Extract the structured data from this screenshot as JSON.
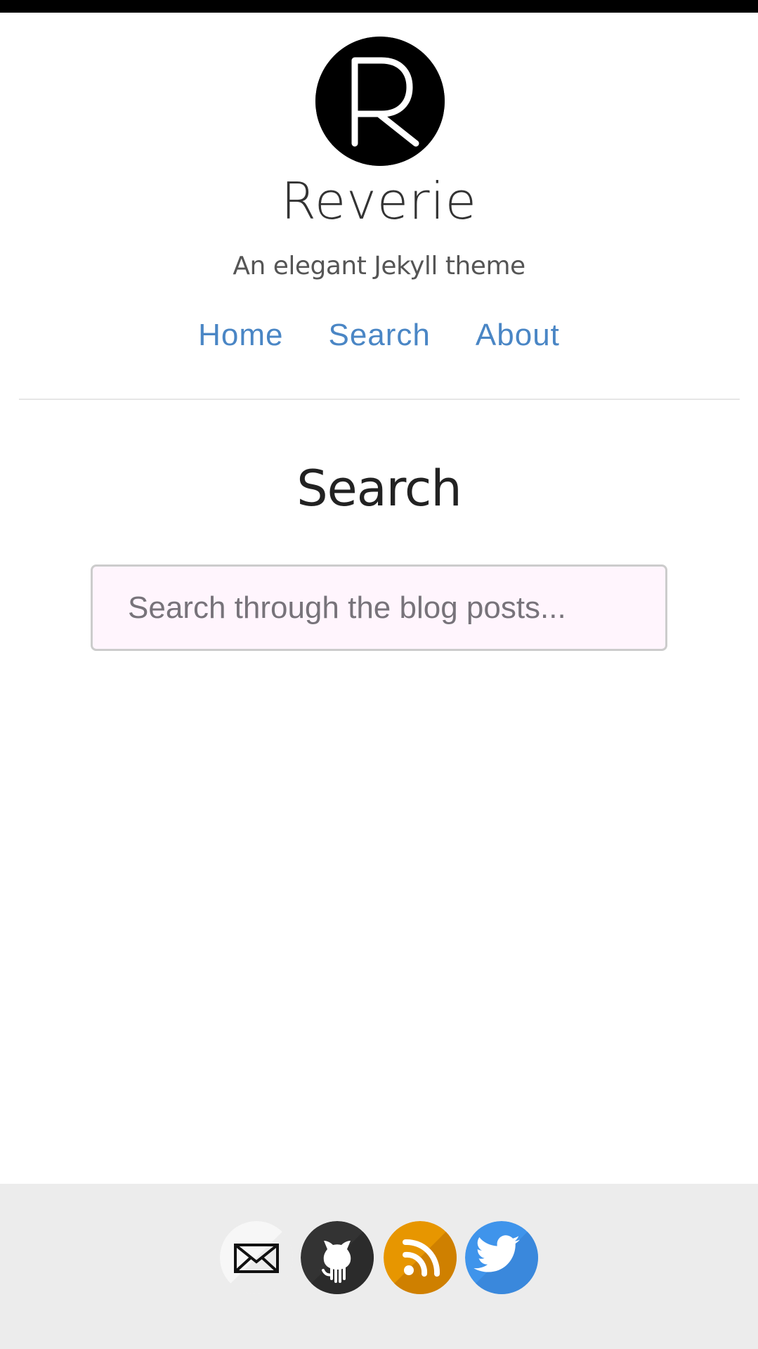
{
  "header": {
    "logo_icon": "reverie-r-logo-icon",
    "site_title": "Reverie",
    "tagline": "An elegant Jekyll theme"
  },
  "nav": {
    "items": [
      {
        "label": "Home"
      },
      {
        "label": "Search"
      },
      {
        "label": "About"
      }
    ],
    "link_color": "#4a86c5"
  },
  "main": {
    "page_title": "Search",
    "search": {
      "placeholder": "Search through the blog posts...",
      "value": ""
    }
  },
  "footer": {
    "social": [
      {
        "icon": "email-icon",
        "color": "#ffffff"
      },
      {
        "icon": "github-icon",
        "color": "#333333"
      },
      {
        "icon": "rss-icon",
        "color": "#e79600"
      },
      {
        "icon": "twitter-icon",
        "color": "#3f94eb"
      }
    ]
  }
}
